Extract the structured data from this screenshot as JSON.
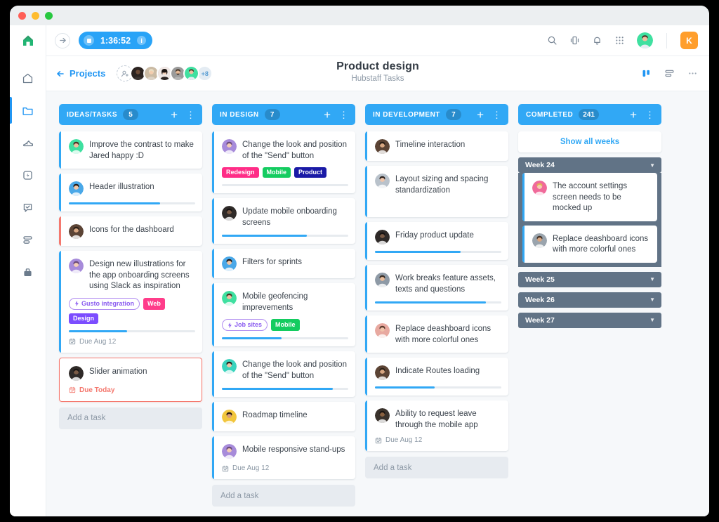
{
  "window": {
    "traffic_lights": [
      "close",
      "minimize",
      "maximize"
    ]
  },
  "rail": {
    "logo": "hubstaff-logo-icon",
    "items": [
      {
        "name": "home-icon",
        "label": "Home",
        "active": false
      },
      {
        "name": "folder-icon",
        "label": "Projects",
        "active": true
      },
      {
        "name": "shoe-icon",
        "label": "Activity",
        "active": false
      },
      {
        "name": "lightning-square-icon",
        "label": "Insights",
        "active": false
      },
      {
        "name": "task-check-icon",
        "label": "Tasks",
        "active": false
      },
      {
        "name": "list-rows-icon",
        "label": "Reports",
        "active": false
      },
      {
        "name": "briefcase-icon",
        "label": "Work",
        "active": false
      }
    ]
  },
  "topbar": {
    "forward_arrow": "→",
    "timer": {
      "time": "1:36:52",
      "stop_icon": "stop-icon",
      "info_icon": "info-icon"
    },
    "icons": [
      "search-icon",
      "phone-vibrate-icon",
      "bell-icon",
      "apps-grid-icon"
    ],
    "user_avatar": "user-avatar",
    "org_badge": "K",
    "org_badge_color": "#ff9e2c"
  },
  "projectbar": {
    "back_label": "Projects",
    "add_member_icon": "add-member-icon",
    "members_overflow": "+8",
    "title": "Product design",
    "subtitle": "Hubstaff Tasks",
    "view_board_icon": "board-view-icon",
    "view_list_icon": "list-view-icon",
    "more_icon": "more-options-icon",
    "add_task_placeholder": "Add a task"
  },
  "columns": [
    {
      "id": "ideas",
      "title": "IDEAS/TASKS",
      "count": "5",
      "add_label": "Add a task",
      "cards": [
        {
          "title": "Improve the contrast to make Jared happy :D",
          "accent": "#31a8f5",
          "avatar": "avatar-green",
          "progress": null,
          "tags": [],
          "due": null
        },
        {
          "title": "Header illustration",
          "accent": "#31a8f5",
          "avatar": "avatar-blue",
          "progress": 72,
          "tags": [],
          "due": null
        },
        {
          "title": "Icons for the dashboard",
          "accent": "#f4786e",
          "avatar": "avatar-brown",
          "progress": null,
          "tags": [],
          "due": null
        },
        {
          "title": "Design new illustrations for the app onboarding screens using Slack as inspiration",
          "accent": "#31a8f5",
          "avatar": "avatar-purple",
          "progress": 46,
          "tags": [
            {
              "label": "Gusto integration",
              "style": "outline",
              "icon": "bolt-icon"
            },
            {
              "label": "Web",
              "color": "#ff3d8a"
            },
            {
              "label": "Design",
              "color": "#7c4dff"
            }
          ],
          "due": "Due Aug 12"
        },
        {
          "title": "Slider animation",
          "accent": "#f4786e",
          "avatar": "avatar-dark",
          "danger": true,
          "progress": null,
          "tags": [],
          "due": "Due Today",
          "due_red": true
        }
      ]
    },
    {
      "id": "in-design",
      "title": "IN DESIGN",
      "count": "7",
      "add_label": "Add a task",
      "cards": [
        {
          "title": "Change the look and position of the \"Send\" button",
          "accent": "#31a8f5",
          "avatar": "avatar-purple",
          "progress": 0,
          "tags": [
            {
              "label": "Redesign",
              "color": "#ff2d87"
            },
            {
              "label": "Mobile",
              "color": "#14cc60"
            },
            {
              "label": "Product",
              "color": "#1a1aa6"
            }
          ],
          "due": null
        },
        {
          "title": "Update mobile onboarding screens",
          "accent": "#31a8f5",
          "avatar": "avatar-dark",
          "progress": 67,
          "tags": [],
          "due": null
        },
        {
          "title": "Filters for sprints",
          "accent": "#31a8f5",
          "avatar": "avatar-blue",
          "progress": null,
          "tags": [],
          "due": null
        },
        {
          "title": "Mobile geofencing imprevements",
          "accent": "#31a8f5",
          "avatar": "avatar-green",
          "progress": 47,
          "tags": [
            {
              "label": "Job sites",
              "style": "outline",
              "icon": "bolt-icon"
            },
            {
              "label": "Mobile",
              "color": "#14cc60"
            }
          ],
          "due": null
        },
        {
          "title": "Change the look and position of the \"Send\" button",
          "accent": "#31a8f5",
          "avatar": "avatar-teal",
          "progress": 88,
          "tags": [],
          "due": null
        },
        {
          "title": "Roadmap timeline",
          "accent": "#31a8f5",
          "avatar": "avatar-yellow",
          "progress": null,
          "tags": [],
          "due": null
        },
        {
          "title": "Mobile responsive stand-ups",
          "accent": "#31a8f5",
          "avatar": "avatar-purple",
          "progress": null,
          "tags": [],
          "due": "Due Aug 12"
        }
      ]
    },
    {
      "id": "in-development",
      "title": "IN DEVELOPMENT",
      "count": "7",
      "add_label": "Add a task",
      "cards": [
        {
          "title": "Timeline interaction",
          "accent": "#31a8f5",
          "avatar": "avatar-brown",
          "progress": null,
          "tags": [],
          "due": null
        },
        {
          "title": "Layout sizing and spacing standardization",
          "accent": "#31a8f5",
          "avatar": "avatar-grey",
          "progress": null,
          "tags": [],
          "due": null,
          "tall": true
        },
        {
          "title": "Friday product update",
          "accent": "#31a8f5",
          "avatar": "avatar-dark",
          "progress": 68,
          "tags": [],
          "due": null
        },
        {
          "title": "Work breaks feature assets, texts and questions",
          "accent": "#31a8f5",
          "avatar": "avatar-glasses",
          "progress": 88,
          "tags": [],
          "due": null
        },
        {
          "title": "Replace deashboard icons with more colorful ones",
          "accent": "#31a8f5",
          "avatar": "avatar-pink",
          "progress": null,
          "tags": [],
          "due": null
        },
        {
          "title": "Indicate Routes loading",
          "accent": "#31a8f5",
          "avatar": "avatar-brown",
          "progress": 47,
          "tags": [],
          "due": null
        },
        {
          "title": "Ability to request leave through the mobile app",
          "accent": "#31a8f5",
          "avatar": "avatar-dark2",
          "progress": null,
          "tags": [],
          "due": "Due Aug 12"
        }
      ]
    }
  ],
  "completed": {
    "title": "COMPLETED",
    "count": "241",
    "show_all_label": "Show all weeks",
    "weeks": [
      {
        "label": "Week 24",
        "expanded": true,
        "cards": [
          {
            "title": "The account settings screen needs to be mocked up",
            "accent": "#31a8f5",
            "avatar": "avatar-blonde"
          },
          {
            "title": "Replace deashboard icons with more colorful ones",
            "accent": "#31a8f5",
            "avatar": "avatar-beard"
          }
        ]
      },
      {
        "label": "Week 25",
        "expanded": false,
        "cards": []
      },
      {
        "label": "Week 26",
        "expanded": false,
        "cards": []
      },
      {
        "label": "Week 27",
        "expanded": false,
        "cards": []
      }
    ]
  }
}
